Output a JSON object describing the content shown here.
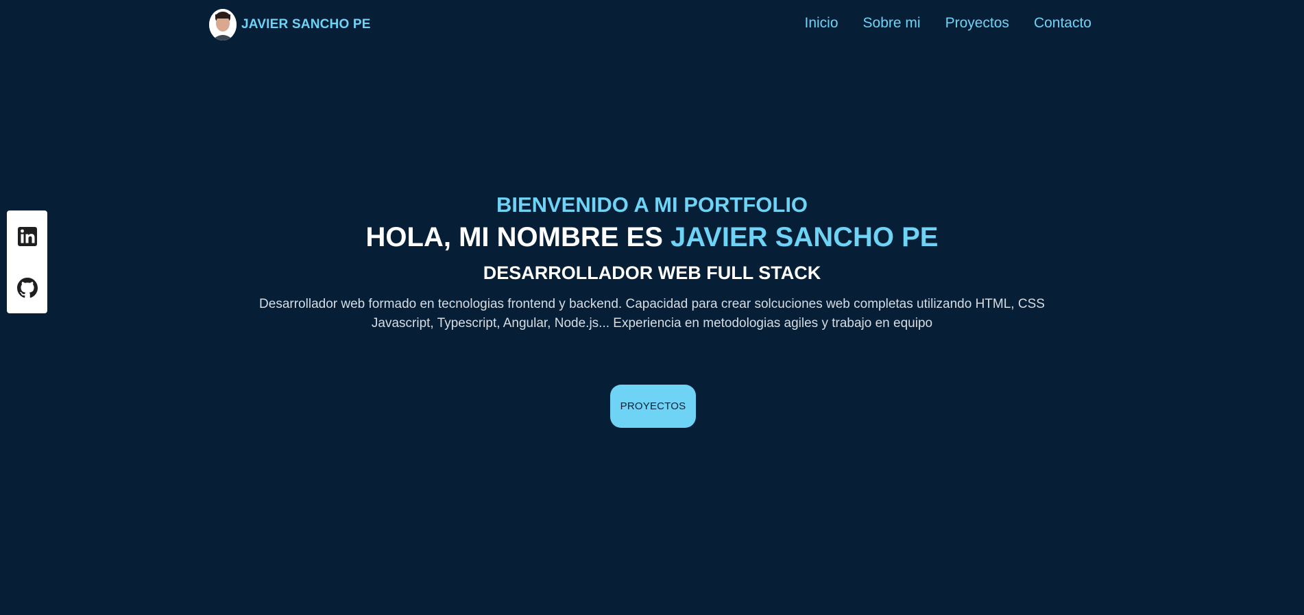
{
  "header": {
    "brand_name": "JAVIER SANCHO PE",
    "nav": [
      {
        "label": "Inicio"
      },
      {
        "label": "Sobre mi"
      },
      {
        "label": "Proyectos"
      },
      {
        "label": "Contacto"
      }
    ]
  },
  "social": {
    "items": [
      {
        "icon": "linkedin-icon"
      },
      {
        "icon": "github-icon"
      }
    ]
  },
  "hero": {
    "welcome": "BIENVENIDO A MI PORTFOLIO",
    "headline_prefix": "HOLA, MI NOMBRE ES ",
    "headline_name": "JAVIER SANCHO PE",
    "role": "DESARROLLADOR WEB FULL STACK",
    "description_line1": "Desarrollador web formado en tecnologias frontend y backend. Capacidad para crear solcuciones web completas utilizando HTML, CSS",
    "description_line2": "Javascript, Typescript, Angular, Node.js... Experiencia en metodologias agiles y trabajo en equipo",
    "cta_label": "PROYECTOS"
  },
  "colors": {
    "background": "#061f37",
    "accent": "#6fd3f6",
    "text": "#ffffff"
  }
}
